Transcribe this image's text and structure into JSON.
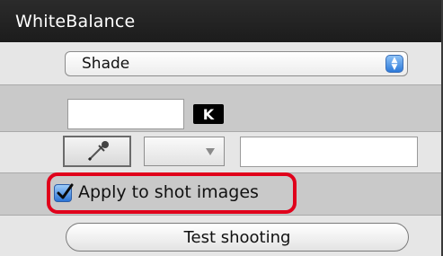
{
  "panel": {
    "title": "WhiteBalance"
  },
  "wb_select": {
    "selected": "Shade"
  },
  "kelvin": {
    "value": "",
    "unit_badge": "K"
  },
  "picker": {
    "eyedropper_icon": "eyedropper-icon",
    "dropdown_value": "",
    "value_field": ""
  },
  "apply": {
    "label": "Apply to shot images",
    "checked": true,
    "highlight_color": "#e0001b"
  },
  "actions": {
    "test_shooting_label": "Test shooting"
  },
  "colors": {
    "titlebar": "#1c1c1c",
    "accent_blue": "#2b74d6"
  }
}
